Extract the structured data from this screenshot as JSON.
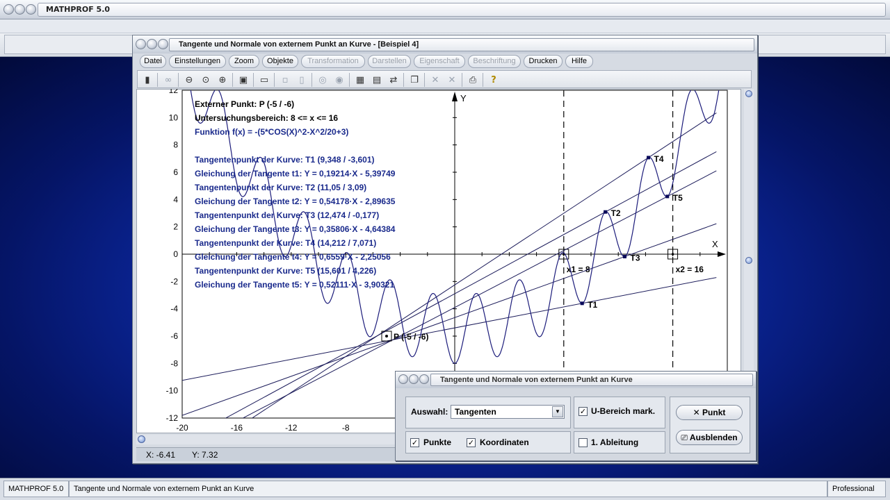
{
  "app": {
    "title": "MATHPROF 5.0"
  },
  "window": {
    "title": "Tangente und Normale von externem Punkt an Kurve - [Beispiel 4]",
    "menu": [
      "Datei",
      "Einstellungen",
      "Zoom",
      "Objekte",
      "Transformation",
      "Darstellen",
      "Eigenschaft",
      "Beschriftung",
      "Drucken",
      "Hilfe"
    ],
    "menu_disabled": [
      "Transformation",
      "Darstellen",
      "Eigenschaft",
      "Beschriftung"
    ]
  },
  "toolbar_icons": [
    "calculator-icon",
    "glasses-icon",
    "zoom-out-icon",
    "zoom-icon",
    "zoom-in-icon",
    "properties-icon",
    "window-icon",
    "frame-icon",
    "frame2-icon",
    "compass-icon",
    "target-icon",
    "table-icon",
    "image-icon",
    "export-icon",
    "copy-icon",
    "cross-icon",
    "cross2-icon",
    "print-icon",
    "help-icon"
  ],
  "plot": {
    "info": [
      "Externer Punkt: P (-5 / -6)",
      "Untersuchungsbereich: 8 <= x <= 16",
      "Funktion f(x) = -(5*COS(X)^2-X^2/20+3)",
      "",
      "Tangentenpunkt der Kurve: T1 (9,348 / -3,601)",
      "Gleichung der Tangente t1: Y = 0,19214·X - 5,39749",
      "Tangentenpunkt der Kurve: T2 (11,05 / 3,09)",
      "Gleichung der Tangente t2: Y = 0,54178·X - 2,89635",
      "Tangentenpunkt der Kurve: T3 (12,474 / -0,177)",
      "Gleichung der Tangente t3: Y = 0,35806·X - 4,64384",
      "Tangentenpunkt der Kurve: T4 (14,212 / 7,071)",
      "Gleichung der Tangente t4: Y = 0,6559·X - 2,25056",
      "Tangentenpunkt der Kurve: T5 (15,601 / 4,226)",
      "Gleichung der Tangente t5: Y = 0,52111·X - 3,90321"
    ],
    "axis_x_label": "X",
    "axis_y_label": "Y",
    "x_ticks": [
      "-20",
      "-16",
      "-12",
      "-8"
    ],
    "y_ticks": [
      "12",
      "10",
      "8",
      "6",
      "4",
      "2",
      "0",
      "-2",
      "-4",
      "-6",
      "-8",
      "-10",
      "-12"
    ],
    "labels": {
      "p": "P (-5 / -6)",
      "x1": "x1 = 8",
      "x2": "x2 = 16",
      "t1": "T1",
      "t2": "T2",
      "t3": "T3",
      "t4": "T4",
      "t5": "T5"
    },
    "colors": {
      "curve": "#1b1b7a",
      "line": "#1b1b5a",
      "info_blue": "#1a2a8c"
    }
  },
  "chart_data": {
    "type": "line",
    "title": "",
    "xlabel": "X",
    "ylabel": "Y",
    "xlim": [
      -20,
      20
    ],
    "ylim": [
      -12,
      12
    ],
    "function": "-(5*COS(X)^2-X^2/20+3)",
    "external_point": [
      -5,
      -6
    ],
    "range": [
      8,
      16
    ],
    "tangent_points": [
      {
        "name": "T1",
        "x": 9.348,
        "y": -3.601
      },
      {
        "name": "T2",
        "x": 11.05,
        "y": 3.09
      },
      {
        "name": "T3",
        "x": 12.474,
        "y": -0.177
      },
      {
        "name": "T4",
        "x": 14.212,
        "y": 7.071
      },
      {
        "name": "T5",
        "x": 15.601,
        "y": 4.226
      }
    ],
    "tangents": [
      {
        "name": "t1",
        "slope": 0.19214,
        "intercept": -5.39749
      },
      {
        "name": "t2",
        "slope": 0.54178,
        "intercept": -2.89635
      },
      {
        "name": "t3",
        "slope": 0.35806,
        "intercept": -4.64384
      },
      {
        "name": "t4",
        "slope": 0.6559,
        "intercept": -2.25056
      },
      {
        "name": "t5",
        "slope": 0.52111,
        "intercept": -3.90321
      }
    ]
  },
  "coords": {
    "x": "X: -6.41",
    "y": "Y: 7.32"
  },
  "dialog": {
    "title": "Tangente und Normale von externem Punkt an Kurve",
    "auswahl_label": "Auswahl:",
    "auswahl_value": "Tangenten",
    "u_bereich_label": "U-Bereich mark.",
    "u_bereich_checked": true,
    "punkte_label": "Punkte",
    "punkte_checked": true,
    "koordinaten_label": "Koordinaten",
    "koordinaten_checked": true,
    "ableitung_label": "1. Ableitung",
    "ableitung_checked": false,
    "punkt_button": "Punkt",
    "ausblenden_button": "Ausblenden"
  },
  "status": {
    "app": "MATHPROF 5.0",
    "module": "Tangente und Normale von externem Punkt an Kurve",
    "edition": "Professional"
  }
}
